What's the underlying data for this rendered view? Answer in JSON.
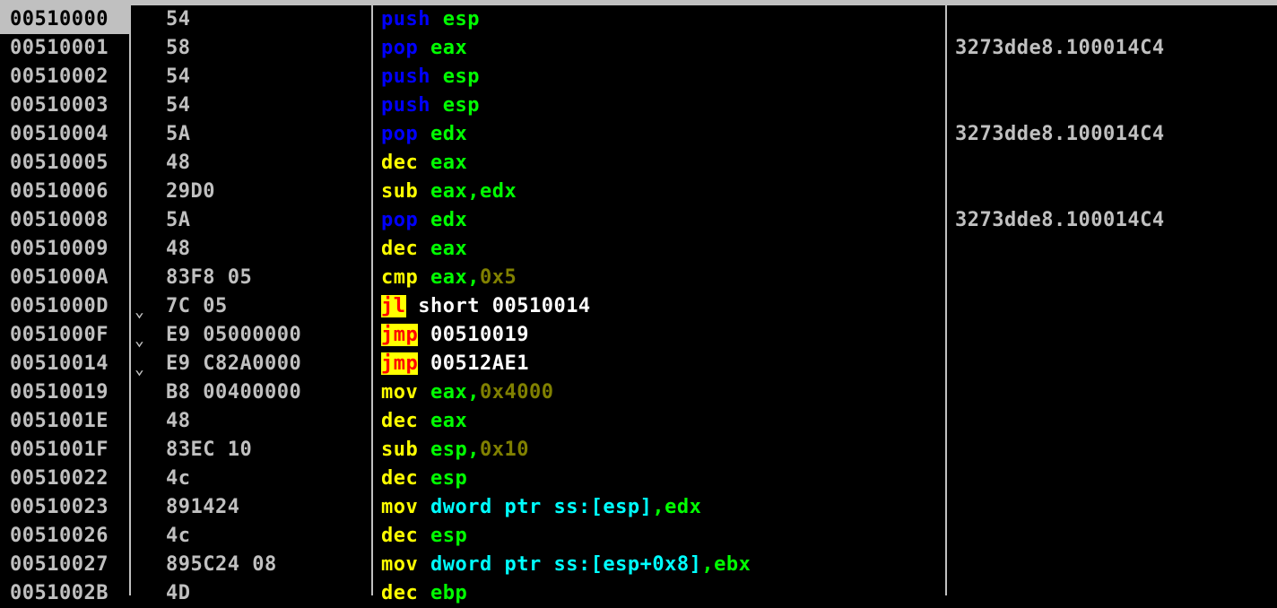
{
  "colors": {
    "background": "#000000",
    "separator": "#c0c0c0",
    "default_text": "#c0c0c0",
    "selected_bg": "#c0c0c0",
    "stack_mnemonic": "#0000ff",
    "arith_mnemonic": "#ffff00",
    "jump_mnemonic_text": "#ff0000",
    "jump_mnemonic_bg": "#ffff00",
    "register": "#00ff00",
    "immediate": "#808000",
    "memory": "#00ffff",
    "address": "#ffffff"
  },
  "disassembly": {
    "rows": [
      {
        "address": "00510000",
        "jump": "",
        "hex": "54",
        "mnemonic": "push",
        "mclass": "stack",
        "operands": [
          {
            "t": " "
          },
          {
            "t": "esp",
            "c": "reg"
          }
        ],
        "comment": "",
        "selected": true
      },
      {
        "address": "00510001",
        "jump": "",
        "hex": "58",
        "mnemonic": "pop",
        "mclass": "stack",
        "operands": [
          {
            "t": " "
          },
          {
            "t": "eax",
            "c": "reg"
          }
        ],
        "comment": "3273dde8.100014C4"
      },
      {
        "address": "00510002",
        "jump": "",
        "hex": "54",
        "mnemonic": "push",
        "mclass": "stack",
        "operands": [
          {
            "t": " "
          },
          {
            "t": "esp",
            "c": "reg"
          }
        ],
        "comment": ""
      },
      {
        "address": "00510003",
        "jump": "",
        "hex": "54",
        "mnemonic": "push",
        "mclass": "stack",
        "operands": [
          {
            "t": " "
          },
          {
            "t": "esp",
            "c": "reg"
          }
        ],
        "comment": ""
      },
      {
        "address": "00510004",
        "jump": "",
        "hex": "5A",
        "mnemonic": "pop",
        "mclass": "stack",
        "operands": [
          {
            "t": " "
          },
          {
            "t": "edx",
            "c": "reg"
          }
        ],
        "comment": "3273dde8.100014C4"
      },
      {
        "address": "00510005",
        "jump": "",
        "hex": "48",
        "mnemonic": "dec",
        "mclass": "arith",
        "operands": [
          {
            "t": " "
          },
          {
            "t": "eax",
            "c": "reg"
          }
        ],
        "comment": ""
      },
      {
        "address": "00510006",
        "jump": "",
        "hex": "29D0",
        "mnemonic": "sub",
        "mclass": "arith",
        "operands": [
          {
            "t": " "
          },
          {
            "t": "eax,edx",
            "c": "reg"
          }
        ],
        "comment": ""
      },
      {
        "address": "00510008",
        "jump": "",
        "hex": "5A",
        "mnemonic": "pop",
        "mclass": "stack",
        "operands": [
          {
            "t": " "
          },
          {
            "t": "edx",
            "c": "reg"
          }
        ],
        "comment": "3273dde8.100014C4"
      },
      {
        "address": "00510009",
        "jump": "",
        "hex": "48",
        "mnemonic": "dec",
        "mclass": "arith",
        "operands": [
          {
            "t": " "
          },
          {
            "t": "eax",
            "c": "reg"
          }
        ],
        "comment": ""
      },
      {
        "address": "0051000A",
        "jump": "",
        "hex": "83F8 05",
        "mnemonic": "cmp",
        "mclass": "arith",
        "operands": [
          {
            "t": " "
          },
          {
            "t": "eax,",
            "c": "reg"
          },
          {
            "t": "0x5",
            "c": "imm"
          }
        ],
        "comment": ""
      },
      {
        "address": "0051000D",
        "jump": "⌄",
        "hex": "7C 05",
        "mnemonic": "jl",
        "mclass": "jmp",
        "operands": [
          {
            "t": " short ",
            "c": "plain"
          },
          {
            "t": "00510014",
            "c": "addr"
          }
        ],
        "comment": ""
      },
      {
        "address": "0051000F",
        "jump": "⌄",
        "hex": "E9 05000000",
        "mnemonic": "jmp",
        "mclass": "jmp",
        "operands": [
          {
            "t": " "
          },
          {
            "t": "00510019",
            "c": "addr"
          }
        ],
        "comment": ""
      },
      {
        "address": "00510014",
        "jump": "⌄",
        "hex": "E9 C82A0000",
        "mnemonic": "jmp",
        "mclass": "jmp",
        "operands": [
          {
            "t": " "
          },
          {
            "t": "00512AE1",
            "c": "addr"
          }
        ],
        "comment": ""
      },
      {
        "address": "00510019",
        "jump": "",
        "hex": "B8 00400000",
        "mnemonic": "mov",
        "mclass": "arith",
        "operands": [
          {
            "t": " "
          },
          {
            "t": "eax,",
            "c": "reg"
          },
          {
            "t": "0x4000",
            "c": "imm"
          }
        ],
        "comment": ""
      },
      {
        "address": "0051001E",
        "jump": "",
        "hex": "48",
        "mnemonic": "dec",
        "mclass": "arith",
        "operands": [
          {
            "t": " "
          },
          {
            "t": "eax",
            "c": "reg"
          }
        ],
        "comment": ""
      },
      {
        "address": "0051001F",
        "jump": "",
        "hex": "83EC 10",
        "mnemonic": "sub",
        "mclass": "arith",
        "operands": [
          {
            "t": " "
          },
          {
            "t": "esp,",
            "c": "reg"
          },
          {
            "t": "0x10",
            "c": "imm"
          }
        ],
        "comment": ""
      },
      {
        "address": "00510022",
        "jump": "",
        "hex": "4c",
        "mnemonic": "dec",
        "mclass": "arith",
        "operands": [
          {
            "t": " "
          },
          {
            "t": "esp",
            "c": "reg"
          }
        ],
        "comment": ""
      },
      {
        "address": "00510023",
        "jump": "",
        "hex": "891424",
        "mnemonic": "mov",
        "mclass": "arith",
        "operands": [
          {
            "t": " "
          },
          {
            "t": "dword ptr ss:[esp]",
            "c": "mem"
          },
          {
            "t": ",edx",
            "c": "reg"
          }
        ],
        "comment": ""
      },
      {
        "address": "00510026",
        "jump": "",
        "hex": "4c",
        "mnemonic": "dec",
        "mclass": "arith",
        "operands": [
          {
            "t": " "
          },
          {
            "t": "esp",
            "c": "reg"
          }
        ],
        "comment": ""
      },
      {
        "address": "00510027",
        "jump": "",
        "hex": "895C24 08",
        "mnemonic": "mov",
        "mclass": "arith",
        "operands": [
          {
            "t": " "
          },
          {
            "t": "dword ptr ss:[esp+0x8]",
            "c": "mem"
          },
          {
            "t": ",ebx",
            "c": "reg"
          }
        ],
        "comment": ""
      },
      {
        "address": "0051002B",
        "jump": "",
        "hex": "4D",
        "mnemonic": "dec",
        "mclass": "arith",
        "operands": [
          {
            "t": " "
          },
          {
            "t": "ebp",
            "c": "reg"
          }
        ],
        "comment": ""
      }
    ]
  }
}
